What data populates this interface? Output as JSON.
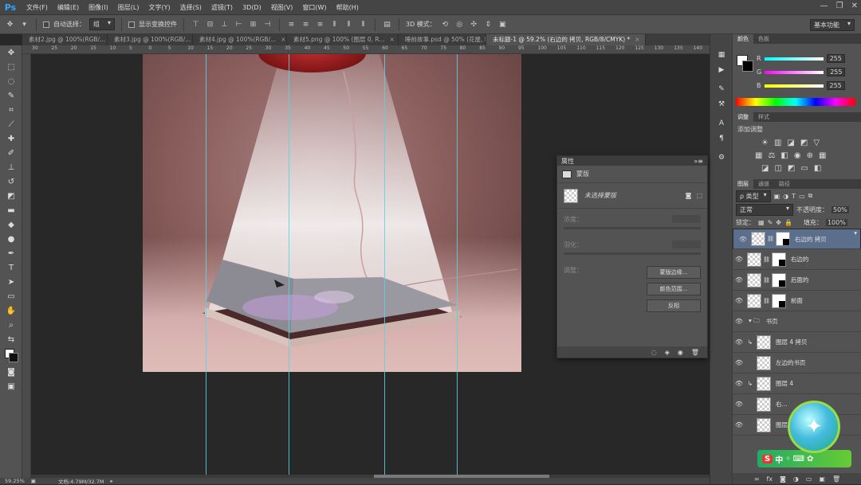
{
  "app": {
    "logo": "Ps"
  },
  "menu": [
    "文件(F)",
    "编辑(E)",
    "图像(I)",
    "图层(L)",
    "文字(Y)",
    "选择(S)",
    "滤镜(T)",
    "3D(D)",
    "视图(V)",
    "窗口(W)",
    "帮助(H)"
  ],
  "window_controls": {
    "minimize": "—",
    "restore": "❐",
    "close": "✕"
  },
  "options": {
    "auto_select_label": "自动选择：",
    "auto_select_value": "组",
    "show_transform_label": "显示变换控件",
    "mode_3d_label": "3D 模式：",
    "workspace": "基本功能"
  },
  "tabs": [
    {
      "label": "素材2.jpg @ 100%(RGB/...",
      "close": "×"
    },
    {
      "label": "素材3.jpg @ 100%(RGB/...",
      "close": "×"
    },
    {
      "label": "素材4.jpg @ 100%(RGB/...",
      "close": "×"
    },
    {
      "label": "素材5.png @ 100% (图层 0, R...",
      "close": "×"
    },
    {
      "label": "睡前故事.psd @ 50% (花屋, R...",
      "close": "×"
    },
    {
      "label": "未标题-1 @ 59.2% (右边的 拷贝, RGB/8/CMYK) *",
      "close": "×"
    }
  ],
  "ruler_ticks": [
    "30",
    "25",
    "20",
    "15",
    "10",
    "5",
    "0",
    "5",
    "10",
    "15",
    "20",
    "25",
    "30",
    "35",
    "40",
    "45",
    "50",
    "55",
    "60",
    "65",
    "70",
    "75",
    "80",
    "85",
    "90",
    "95",
    "100",
    "105",
    "110",
    "115",
    "120",
    "125",
    "130",
    "135",
    "140"
  ],
  "status": {
    "zoom": "59.25%",
    "doc_size": "文档:4.79M/32.7M"
  },
  "color_panel": {
    "tabs": [
      "颜色",
      "色板"
    ],
    "channels": [
      {
        "label": "R",
        "value": "255",
        "color": "#e05050"
      },
      {
        "label": "G",
        "value": "255",
        "color": "#50c050"
      },
      {
        "label": "B",
        "value": "255",
        "color": "#5070e0"
      }
    ]
  },
  "adjust_panel": {
    "tabs": [
      "调整",
      "样式"
    ],
    "title": "添加调整"
  },
  "properties": {
    "tab": "属性",
    "header": "蒙版",
    "mask_status": "未选择蒙版",
    "density_label": "浓度：",
    "feather_label": "羽化：",
    "adjust_label": "调整：",
    "buttons": [
      "蒙版边缘...",
      "颜色范围...",
      "反相"
    ]
  },
  "layers_panel": {
    "tabs": [
      "图层",
      "通道",
      "路径"
    ],
    "filter_kind": "ρ 类型",
    "blend_mode": "正常",
    "opacity_label": "不透明度：",
    "opacity": "50%",
    "lock_label": "锁定：",
    "fill_label": "填充：",
    "fill": "100%",
    "layers": [
      {
        "name": "右边的 拷贝",
        "type": "mask",
        "selected": true
      },
      {
        "name": "右边的",
        "type": "mask",
        "selected": false
      },
      {
        "name": "后面的",
        "type": "mask",
        "selected": false
      },
      {
        "name": "前面",
        "type": "mask",
        "selected": false
      },
      {
        "name": "书页",
        "type": "group",
        "selected": false
      },
      {
        "name": "图层 4 拷贝",
        "type": "clip",
        "selected": false
      },
      {
        "name": "左边的书页",
        "type": "plain",
        "selected": false
      },
      {
        "name": "图层 4",
        "type": "clip",
        "selected": false
      },
      {
        "name": "右...",
        "type": "plain",
        "selected": false
      },
      {
        "name": "图层 3",
        "type": "plain",
        "selected": false
      }
    ]
  },
  "watermark": {
    "text": "中"
  }
}
